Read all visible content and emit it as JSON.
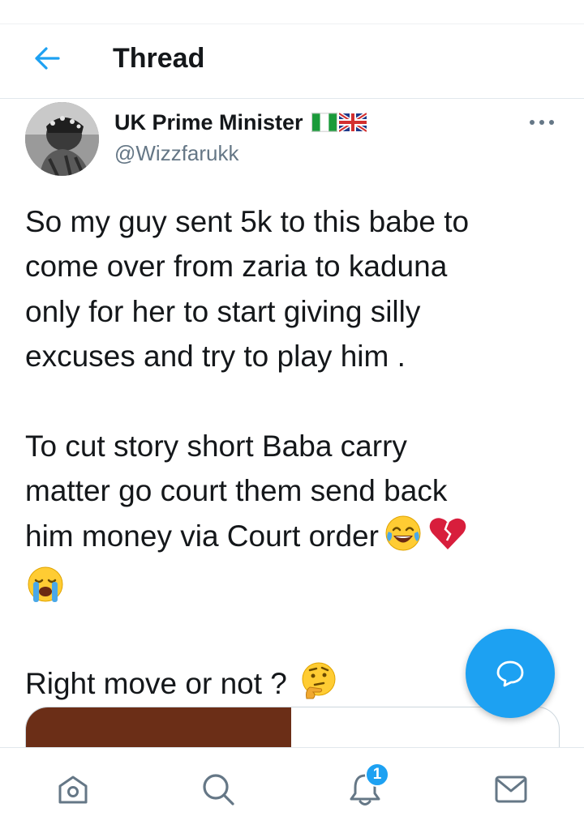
{
  "header": {
    "title": "Thread",
    "back_icon": "arrow-left-icon"
  },
  "tweet": {
    "author": {
      "display_name": "UK Prime Minister",
      "handle": "@Wizzfarukk",
      "flags": [
        "nigeria-flag-icon",
        "uk-flag-icon"
      ]
    },
    "more_icon": "more-horizontal-icon",
    "paragraphs": [
      {
        "lines": [
          "So my guy sent 5k to this babe to",
          "come over from zaria to kaduna",
          "only for her to start giving silly",
          "excuses and try to play him ."
        ]
      },
      {
        "lines": [
          "To cut story short Baba carry",
          "matter go court them send back",
          "him money via Court order"
        ],
        "emojis": [
          "face-with-tears-of-joy-emoji",
          "broken-heart-emoji",
          "loudly-crying-face-emoji"
        ]
      },
      {
        "lines": [
          "Right move or not ?"
        ],
        "emojis": [
          "thinking-face-emoji"
        ]
      }
    ]
  },
  "fab": {
    "icon": "chat-bubble-icon"
  },
  "bottom_nav": {
    "items": [
      {
        "name": "home",
        "icon": "home-icon"
      },
      {
        "name": "search",
        "icon": "search-icon"
      },
      {
        "name": "notifications",
        "icon": "bell-icon",
        "badge": "1"
      },
      {
        "name": "messages",
        "icon": "mail-icon"
      }
    ]
  },
  "colors": {
    "accent": "#1da1f2",
    "text": "#14171a",
    "secondary_text": "#657786",
    "divider": "#e1e8ed"
  }
}
